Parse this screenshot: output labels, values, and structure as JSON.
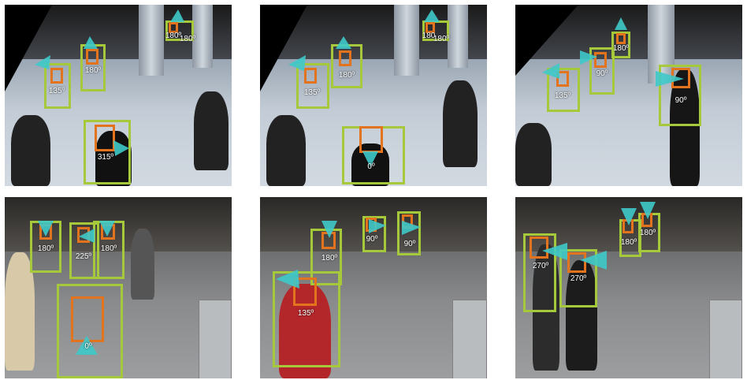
{
  "panels": [
    {
      "id": "top-left",
      "labels": [
        "180º",
        "180º",
        "180º",
        "135º",
        "315º"
      ]
    },
    {
      "id": "top-middle",
      "labels": [
        "180",
        "180º",
        "180º",
        "135º",
        "0º"
      ]
    },
    {
      "id": "top-right",
      "labels": [
        "180º",
        "90º",
        "135º",
        "90º"
      ]
    },
    {
      "id": "bottom-left",
      "labels": [
        "180º",
        "225º",
        "180º",
        "0º"
      ]
    },
    {
      "id": "bottom-middle",
      "labels": [
        "90º",
        "90º",
        "180º",
        "135º"
      ]
    },
    {
      "id": "bottom-right",
      "labels": [
        "180º",
        "180º",
        "270º",
        "270º"
      ]
    }
  ],
  "colors": {
    "body_box": "#a5c93a",
    "head_box": "#e3731c",
    "arrow": "#3ec9c9",
    "label": "#ffffff"
  }
}
